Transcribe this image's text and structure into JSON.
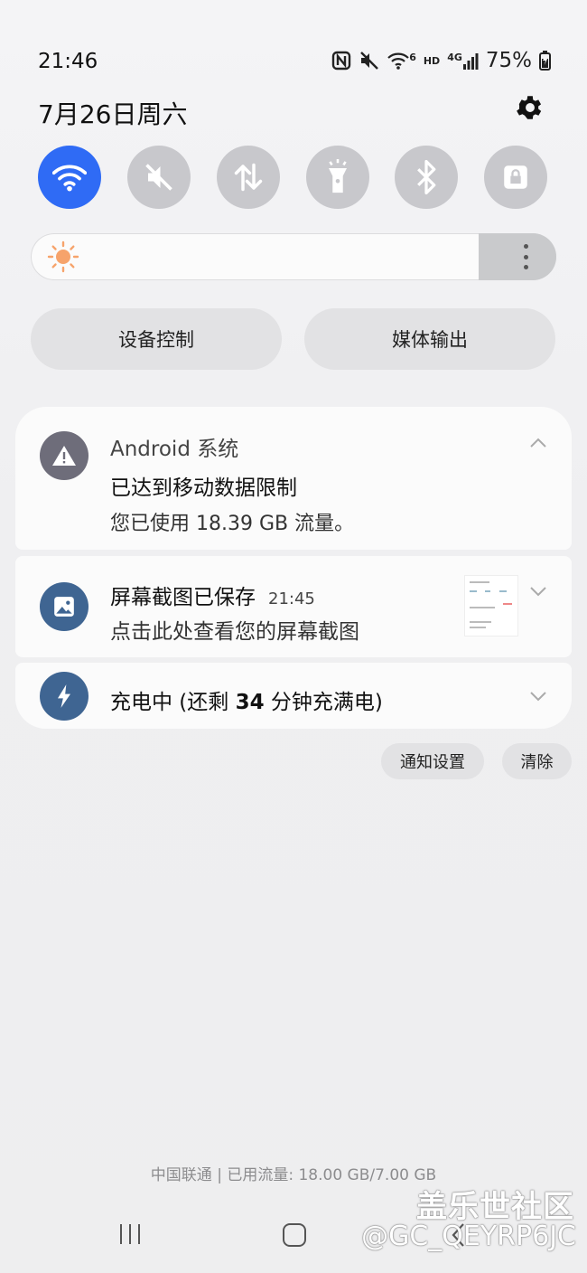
{
  "status": {
    "time": "21:46",
    "net_gen": "6",
    "hd": "HD",
    "cell_gen": "4G",
    "battery": "75%"
  },
  "header": {
    "date": "7月26日周六"
  },
  "toggles": [
    {
      "icon": "wifi-icon",
      "on": true
    },
    {
      "icon": "mute-icon",
      "on": false
    },
    {
      "icon": "mobile-data-icon",
      "on": false
    },
    {
      "icon": "flashlight-icon",
      "on": false
    },
    {
      "icon": "bluetooth-icon",
      "on": false
    },
    {
      "icon": "lock-icon",
      "on": false
    }
  ],
  "brightness": {
    "level": 0.05
  },
  "buttons": {
    "device_control": "设备控制",
    "media_output": "媒体输出"
  },
  "notifications": [
    {
      "app": "Android 系统",
      "title": "已达到移动数据限制",
      "body": "您已使用 18.39 GB 流量。"
    },
    {
      "title": "屏幕截图已保存",
      "time": "21:45",
      "body": "点击此处查看您的屏幕截图"
    },
    {
      "title_prefix": "充电中 (还剩 ",
      "minutes": "34",
      "title_suffix": " 分钟充满电)"
    }
  ],
  "actions": {
    "settings": "通知设置",
    "clear": "清除"
  },
  "footer": {
    "carrier_usage": "中国联通 | 已用流量: 18.00 GB/7.00 GB"
  },
  "watermark": {
    "site": "盖乐世社区",
    "user": "@GC_QEYRP6JC"
  }
}
